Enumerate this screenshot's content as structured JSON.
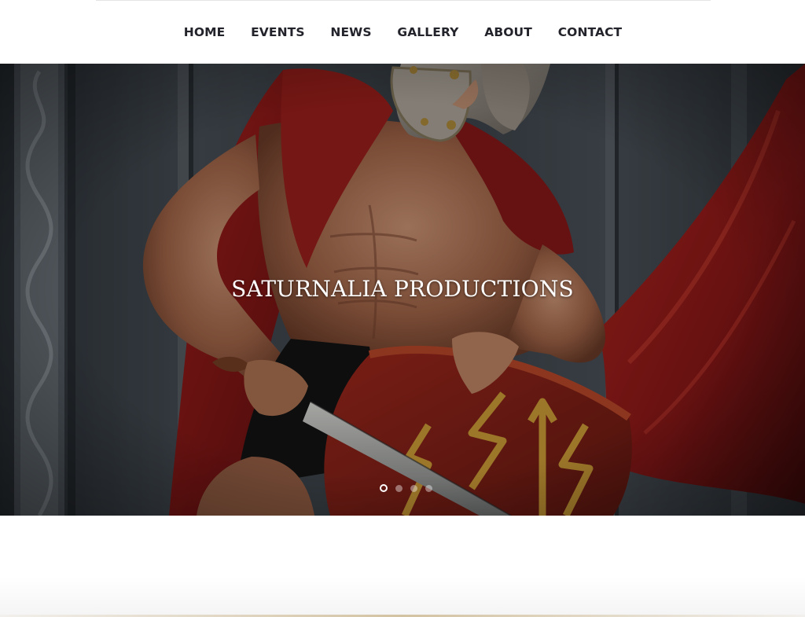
{
  "nav": {
    "items": [
      {
        "label": "HOME"
      },
      {
        "label": "EVENTS"
      },
      {
        "label": "NEWS"
      },
      {
        "label": "GALLERY"
      },
      {
        "label": "ABOUT"
      },
      {
        "label": "CONTACT"
      }
    ]
  },
  "hero": {
    "title": "SATURNALIA PRODUCTIONS",
    "slider": {
      "slide_count": 4,
      "active_slide": 1
    }
  },
  "colors": {
    "nav_text": "#23232b",
    "header_background": "#ffffff",
    "hero_title": "#ffffff",
    "cape_red": "#8e1a19",
    "wall_gray": "#3c434a",
    "shield_gold": "#d9a43a"
  }
}
